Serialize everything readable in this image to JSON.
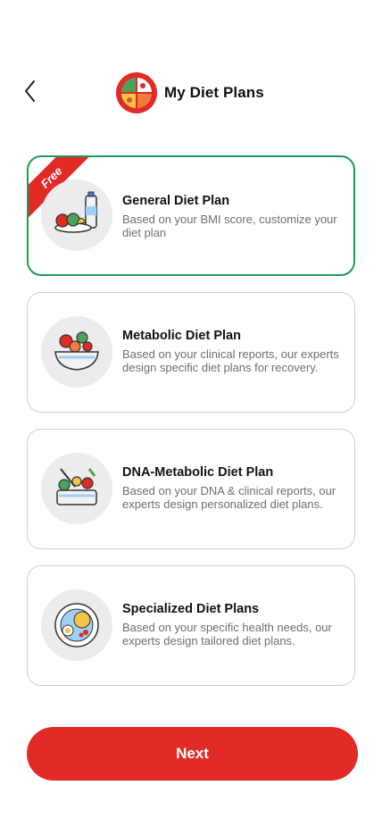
{
  "header": {
    "back_icon": "chevron-left-icon",
    "logo_icon": "diet-plate-logo-icon",
    "title": "My Diet Plans"
  },
  "plans": [
    {
      "badge": "Free",
      "title": "General Diet Plan",
      "description": "Based on your BMI  score, customize your diet plan",
      "icon": "groceries-icon",
      "selected": true
    },
    {
      "title": "Metabolic Diet Plan",
      "description": "Based on your clinical reports, our experts design specific diet plans for recovery.",
      "icon": "salad-bowl-icon",
      "selected": false
    },
    {
      "title": "DNA-Metabolic Diet Plan",
      "description": "Based on your DNA & clinical reports, our experts design personalized diet plans.",
      "icon": "meal-box-icon",
      "selected": false
    },
    {
      "title": "Specialized Diet Plans",
      "description": "Based on your specific health needs, our experts design tailored diet plans.",
      "icon": "breakfast-plate-icon",
      "selected": false
    }
  ],
  "next_label": "Next",
  "colors": {
    "accent": "#e22a26",
    "selected_border": "#1f9a5a",
    "card_border": "#cfcfcf",
    "muted_text": "#6e6e6e",
    "icon_bg": "#ececec"
  }
}
